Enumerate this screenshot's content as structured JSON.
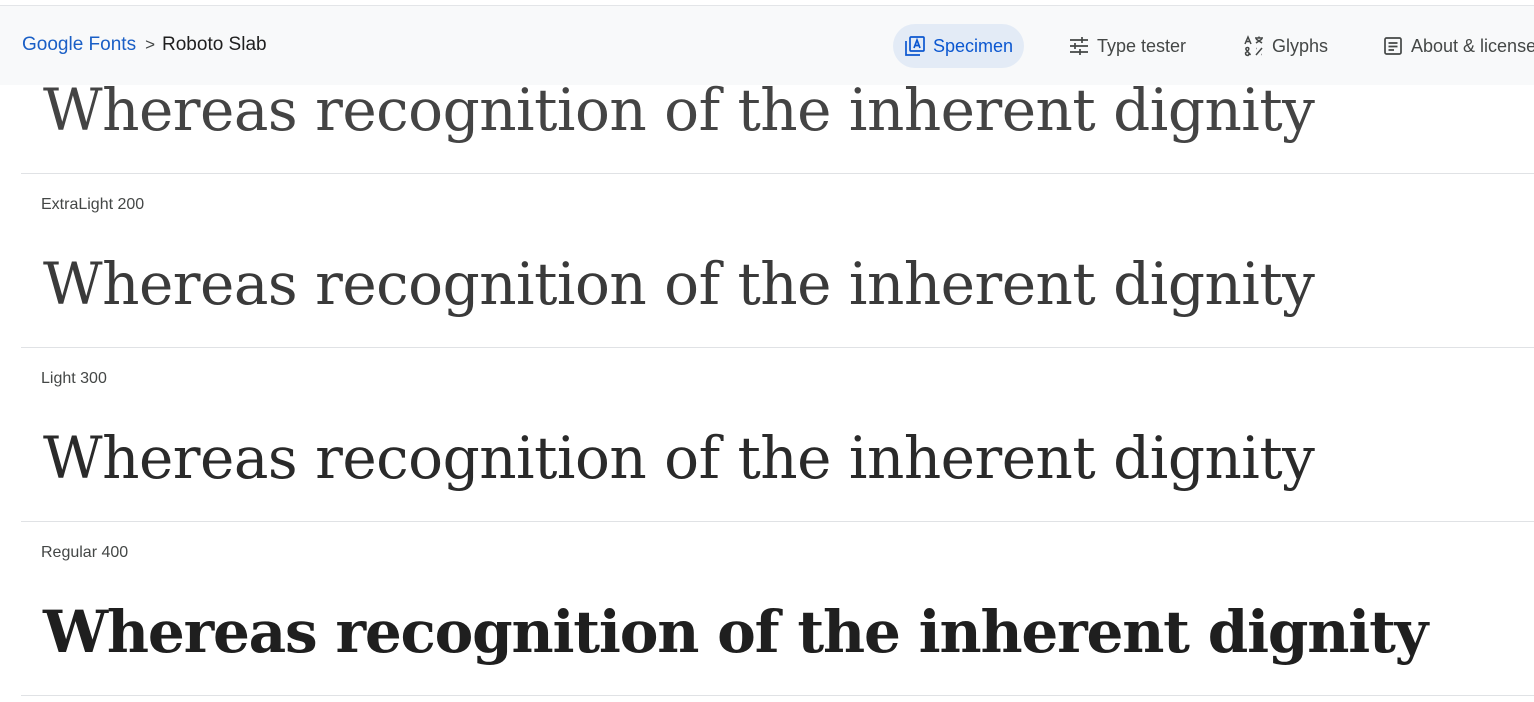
{
  "breadcrumb": {
    "root": "Google Fonts",
    "separator": ">",
    "current": "Roboto Slab"
  },
  "tabs": [
    {
      "label": "Specimen",
      "icon": "specimen-icon",
      "active": true
    },
    {
      "label": "Type tester",
      "icon": "sliders-icon",
      "active": false
    },
    {
      "label": "Glyphs",
      "icon": "glyphs-icon",
      "active": false
    },
    {
      "label": "About & license",
      "icon": "article-icon",
      "active": false
    }
  ],
  "specimens": [
    {
      "label": "",
      "sample": "Whereas recognition of the inherent dignity",
      "weight": 100
    },
    {
      "label": "ExtraLight 200",
      "sample": "Whereas recognition of the inherent dignity",
      "weight": 200
    },
    {
      "label": "Light 300",
      "sample": "Whereas recognition of the inherent dignity",
      "weight": 300
    },
    {
      "label": "Regular 400",
      "sample": "Whereas recognition of the inherent dignity",
      "weight": 400
    }
  ],
  "colors": {
    "accent": "#0b57d0",
    "link": "#1a5fc6",
    "active_tab_bg": "#e3ebf6",
    "topbar_bg": "#f8f9fa"
  }
}
